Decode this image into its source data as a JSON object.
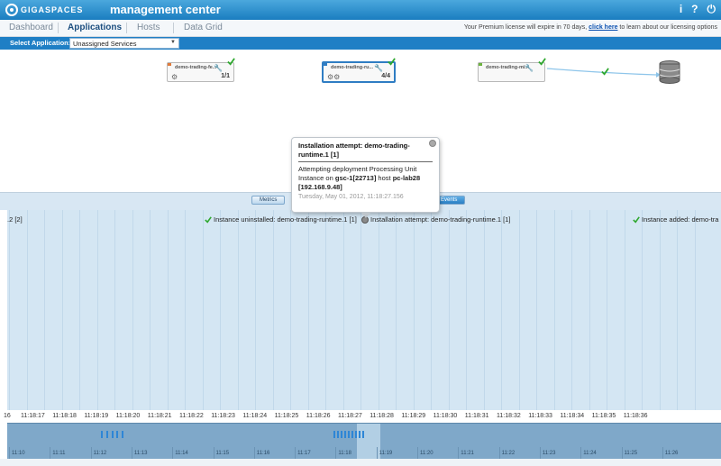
{
  "header": {
    "logo_text": "GIGASPACES",
    "title": "management center",
    "icons": {
      "info": "i",
      "help": "?",
      "power": "⏻"
    }
  },
  "nav": {
    "tabs": [
      {
        "label": "Dashboard",
        "active": false
      },
      {
        "label": "Applications",
        "active": true
      },
      {
        "label": "Hosts",
        "active": false
      },
      {
        "label": "Data Grid",
        "active": false
      }
    ],
    "premium": {
      "prefix": "Your Premium license will expire in 70 days,",
      "link": "click here",
      "suffix": "to learn about our licensing options"
    }
  },
  "app_selector": {
    "label": "Select Application:",
    "value": "Unassigned Services"
  },
  "topology": {
    "nodes": [
      {
        "label": "demo-trading-fe...",
        "count": "1/1",
        "selected": false,
        "stripe": "#e07a3a"
      },
      {
        "label": "demo-trading-ru...",
        "count": "4/4",
        "selected": true,
        "stripe": "#2f7dc3"
      },
      {
        "label": "demo-trading-mi...",
        "count": "",
        "selected": false,
        "stripe": "#6cb33e"
      }
    ],
    "colors": {
      "check": "#2fa82f",
      "edge": "#8ec5ea"
    }
  },
  "popup": {
    "title": "Installation attempt: demo-trading-runtime.1 [1]",
    "line1": "Attempting deployment Processing Unit",
    "line2_pre": "Instance on",
    "line2_bold1": "gsc-1[22713]",
    "line2_mid": "host",
    "line2_bold2": "pc-lab28",
    "line3_bold": "[192.168.9.48]",
    "date": "Tuesday, May 01, 2012, 11:18:27.156"
  },
  "strip_tabs": [
    {
      "label": "Metrics",
      "active": false
    },
    {
      "label": "Events",
      "active": true
    }
  ],
  "events": [
    {
      "text": ".2 [2]",
      "icon": "none"
    },
    {
      "text": "Instance uninstalled: demo-trading-runtime.1 [1]",
      "icon": "check"
    },
    {
      "text": "Installation attempt: demo-trading-runtime.1 [1]",
      "icon": "gray"
    },
    {
      "text": "Instance added: demo-tra",
      "icon": "check"
    }
  ],
  "time_scale": [
    "16",
    "11:18:17",
    "11:18:18",
    "11:18:19",
    "11:18:20",
    "11:18:21",
    "11:18:22",
    "11:18:23",
    "11:18:24",
    "11:18:25",
    "11:18:26",
    "11:18:27",
    "11:18:28",
    "11:18:29",
    "11:18:30",
    "11:18:31",
    "11:18:32",
    "11:18:33",
    "11:18:34",
    "11:18:35",
    "11:18:36"
  ],
  "overview_scale": [
    "11:10",
    "11:11",
    "11:12",
    "11:13",
    "11:14",
    "11:15",
    "11:16",
    "11:17",
    "11:18",
    "11:19",
    "11:20",
    "11:21",
    "11:22",
    "11:23",
    "11:24",
    "11:25",
    "11:26"
  ]
}
